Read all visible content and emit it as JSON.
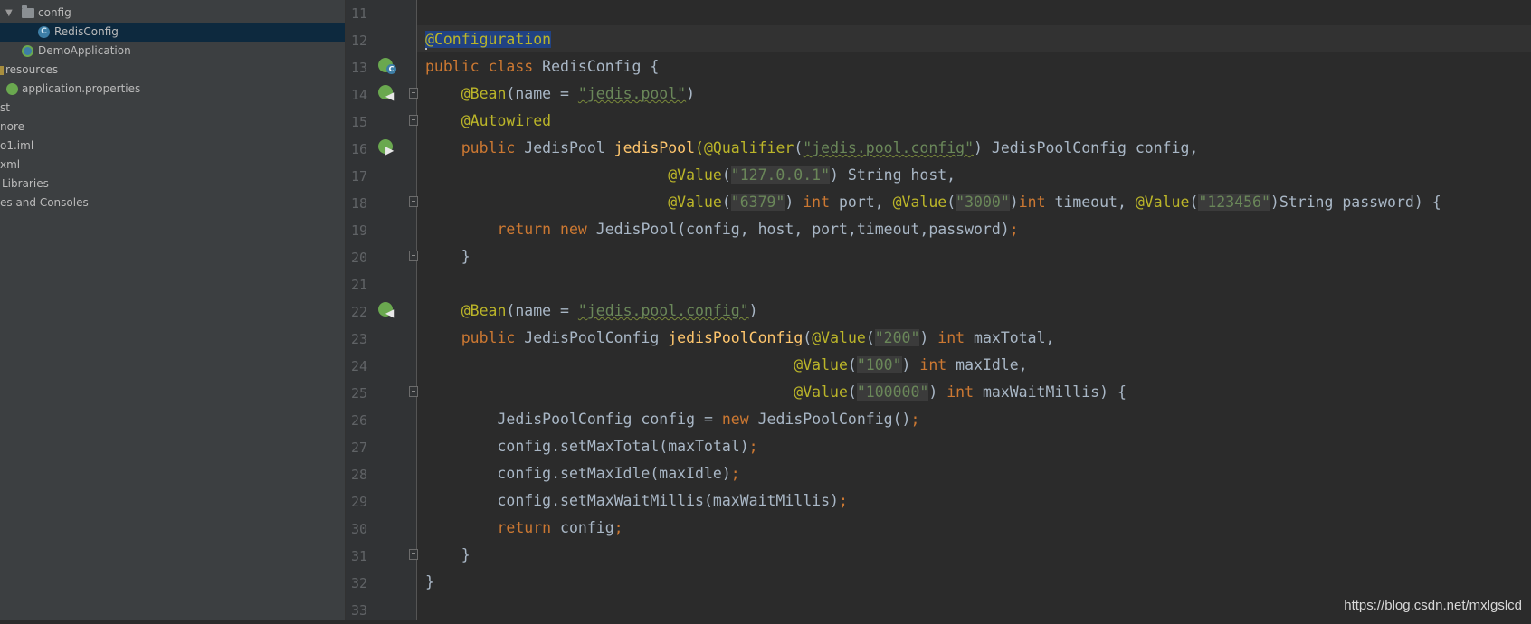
{
  "sidebar": {
    "items": [
      {
        "label": "config"
      },
      {
        "label": "RedisConfig"
      },
      {
        "label": "DemoApplication"
      },
      {
        "label": "resources"
      },
      {
        "label": "application.properties"
      },
      {
        "label": "st"
      },
      {
        "label": "nore"
      },
      {
        "label": "o1.iml"
      },
      {
        "label": "xml"
      },
      {
        "label": "Libraries"
      },
      {
        "label": "es and Consoles"
      }
    ]
  },
  "editor": {
    "line_numbers": [
      "11",
      "12",
      "13",
      "14",
      "15",
      "16",
      "17",
      "18",
      "19",
      "20",
      "21",
      "22",
      "23",
      "24",
      "25",
      "26",
      "27",
      "28",
      "29",
      "30",
      "31",
      "32",
      "33"
    ],
    "t": {
      "configuration": "@Configuration",
      "public": "public",
      "class": "class",
      "redisConfigDecl": " RedisConfig {",
      "bean": "@Bean",
      "nameEq": "(name = ",
      "strJedisPool": "\"jedis.pool\"",
      "closeParen": ")",
      "autowired": "@Autowired",
      "jedisPoolType": " JedisPool ",
      "jedisPoolFn": "jedisPool",
      "qualifier": "(@Qualifier",
      "openParen": "(",
      "strJedisPoolConfig": "\"jedis.pool.config\"",
      "configParam": ") JedisPoolConfig config,",
      "value": "@Value",
      "str127": "\"127.0.0.1\"",
      "hostParam": ") String host,",
      "str6379": "\"6379\"",
      "int": "int",
      "portPart": " port, ",
      "str3000": "\"3000\"",
      "timeoutPart": " timeout, ",
      "str123456": "\"123456\"",
      "passwordPart": ")String password) {",
      "return": "return",
      "new": "new",
      "jedisPoolCtor": " JedisPool(config, host, port,timeout,password)",
      "semicolon": ";",
      "closeBrace": "}",
      "jedisPoolConfigType": " JedisPoolConfig ",
      "jedisPoolConfigFn": "jedisPoolConfig",
      "str200": "\"200\"",
      "maxTotalParam": " maxTotal,",
      "str100": "\"100\"",
      "maxIdleParam": " maxIdle,",
      "str100000": "\"100000\"",
      "maxWaitParam": " maxWaitMillis) {",
      "configNewLeft": "JedisPoolConfig config = ",
      "configCtor": " JedisPoolConfig()",
      "setMaxTotal": "config.setMaxTotal(maxTotal)",
      "setMaxIdle": "config.setMaxIdle(maxIdle)",
      "setMaxWait": "config.setMaxWaitMillis(maxWaitMillis)",
      "configRet": " config",
      "spaceParen": ") "
    }
  },
  "watermark": "https://blog.csdn.net/mxlgslcd",
  "colors": {
    "editor_bg": "#2b2b2b",
    "keyword": "#cc7832",
    "annotation": "#bbb529",
    "string": "#6a8759",
    "method": "#ffc66d",
    "selection": "#214283"
  }
}
